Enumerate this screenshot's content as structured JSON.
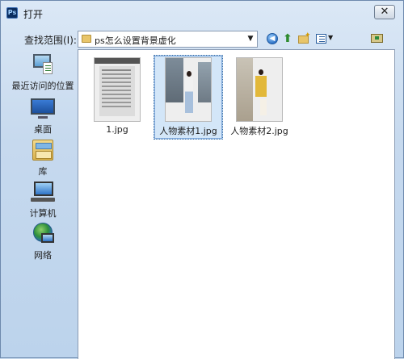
{
  "window": {
    "title": "打开",
    "app_icon_text": "Ps",
    "close_glyph": "✕"
  },
  "lookin": {
    "label": "查找范围(I):",
    "value": "ps怎么设置背景虚化",
    "dropdown_glyph": "▼"
  },
  "toolbar": {
    "back_glyph": "◀",
    "up_glyph": "⬆",
    "newfolder_glyph": "✦",
    "views_arrow_glyph": "▼"
  },
  "places": [
    {
      "label": "最近访问的位置",
      "icon": "recent-places-icon"
    },
    {
      "label": "桌面",
      "icon": "desktop-icon"
    },
    {
      "label": "库",
      "icon": "library-icon"
    },
    {
      "label": "计算机",
      "icon": "computer-icon"
    },
    {
      "label": "网络",
      "icon": "network-icon"
    }
  ],
  "files": [
    {
      "name": "1.jpg",
      "selected": false
    },
    {
      "name": "人物素材1.jpg",
      "selected": true
    },
    {
      "name": "人物素材2.jpg",
      "selected": false
    }
  ],
  "colors": {
    "selection": "#d3e6f8",
    "chrome": "#c6d9ee",
    "accent": "#2f74c7"
  }
}
